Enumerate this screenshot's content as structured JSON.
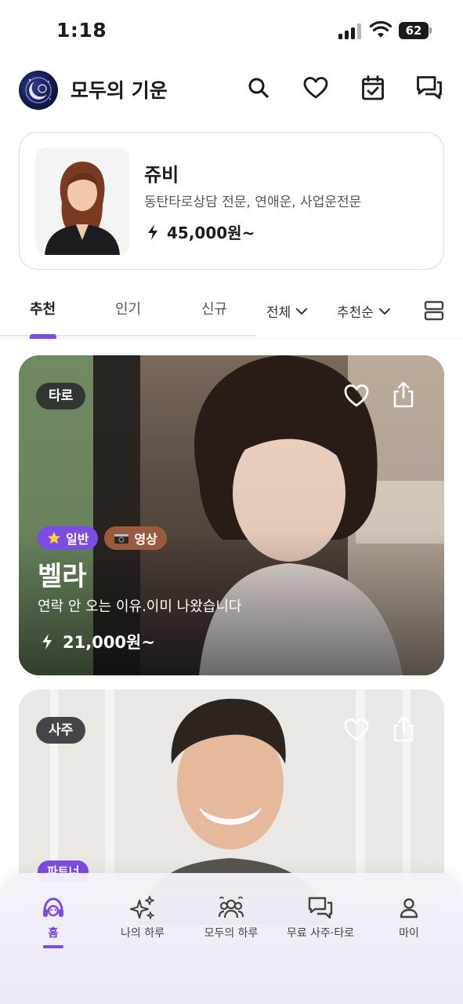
{
  "status_bar": {
    "time": "1:18",
    "battery": "62"
  },
  "header": {
    "title": "모두의 기운"
  },
  "featured": {
    "name": "쥬비",
    "description": "동탄타로상담 전문, 연애운, 사업운전문",
    "price": "45,000원~"
  },
  "tabs": [
    {
      "label": "추천",
      "active": true
    },
    {
      "label": "인기",
      "active": false
    },
    {
      "label": "신규",
      "active": false
    }
  ],
  "filters": {
    "category": "전체",
    "sort": "추천순"
  },
  "cards": [
    {
      "category": "타로",
      "tags": [
        "일반",
        "영상"
      ],
      "name": "벨라",
      "description": "연락 안 오는 이유.이미 나왔습니다",
      "price": "21,000원~"
    },
    {
      "category": "사주",
      "tags": [
        "파트너"
      ]
    }
  ],
  "nav": [
    {
      "label": "홈",
      "active": true
    },
    {
      "label": "나의 하루",
      "active": false
    },
    {
      "label": "모두의 하루",
      "active": false
    },
    {
      "label": "무료 사주·타로",
      "active": false
    },
    {
      "label": "마이",
      "active": false
    }
  ],
  "colors": {
    "accent": "#7b4ce6",
    "tag_brown": "#9b5a3e",
    "badge": "#28282c"
  }
}
